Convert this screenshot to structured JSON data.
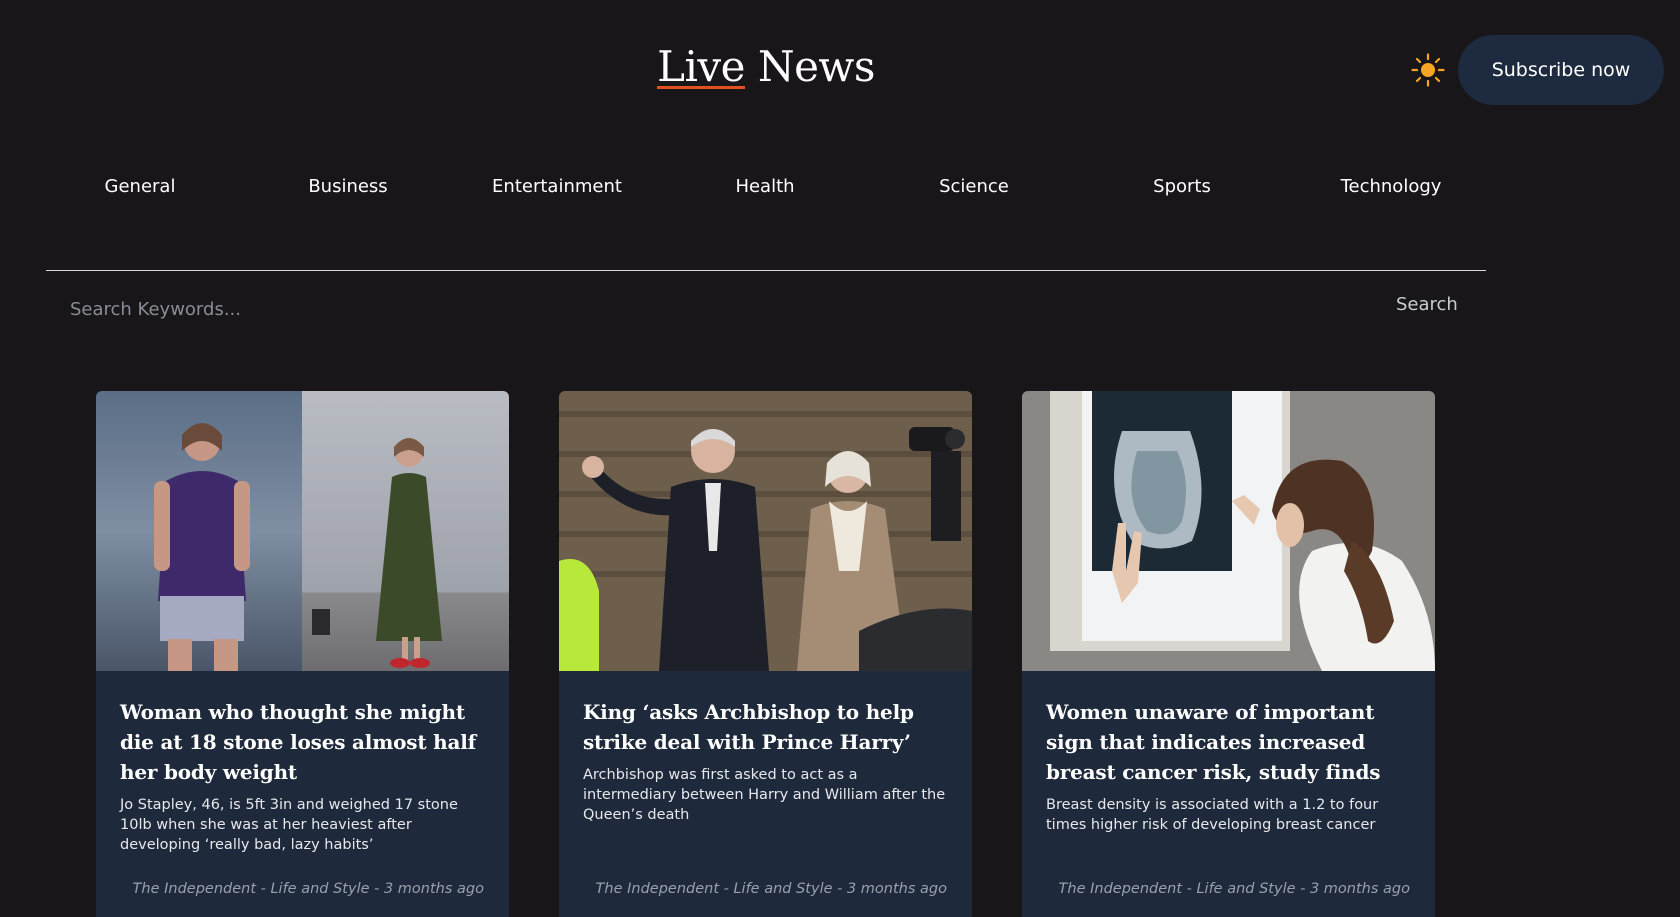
{
  "header": {
    "logo_part1": "Live",
    "logo_part2": "News",
    "theme_toggle_icon": "sun-icon",
    "subscribe_label": "Subscribe now"
  },
  "nav": {
    "items": [
      {
        "label": "General"
      },
      {
        "label": "Business"
      },
      {
        "label": "Entertainment"
      },
      {
        "label": "Health"
      },
      {
        "label": "Science"
      },
      {
        "label": "Sports"
      },
      {
        "label": "Technology"
      }
    ]
  },
  "search": {
    "placeholder": "Search Keywords...",
    "button_label": "Search"
  },
  "articles": [
    {
      "title": "Woman who thought she might die at 18 stone loses almost half her body weight",
      "description": "Jo Stapley, 46, is 5ft 3in and weighed 17 stone 10lb when she was at her heaviest after developing ‘really bad, lazy habits’",
      "source": "The Independent - Life and Style - 3 months ago"
    },
    {
      "title": "King ‘asks Archbishop to help strike deal with Prince Harry’",
      "description": "Archbishop was first asked to act as a intermediary between Harry and William after the Queen’s death",
      "source": "The Independent - Life and Style - 3 months ago"
    },
    {
      "title": "Women unaware of important sign that indicates increased breast cancer risk, study finds",
      "description": "Breast density is associated with a 1.2 to four times higher risk of developing breast cancer",
      "source": "The Independent - Life and Style - 3 months ago"
    }
  ],
  "colors": {
    "background": "#181619",
    "card": "#1e293b",
    "accent_underline": "#e2501f",
    "sun": "#f5a623"
  }
}
